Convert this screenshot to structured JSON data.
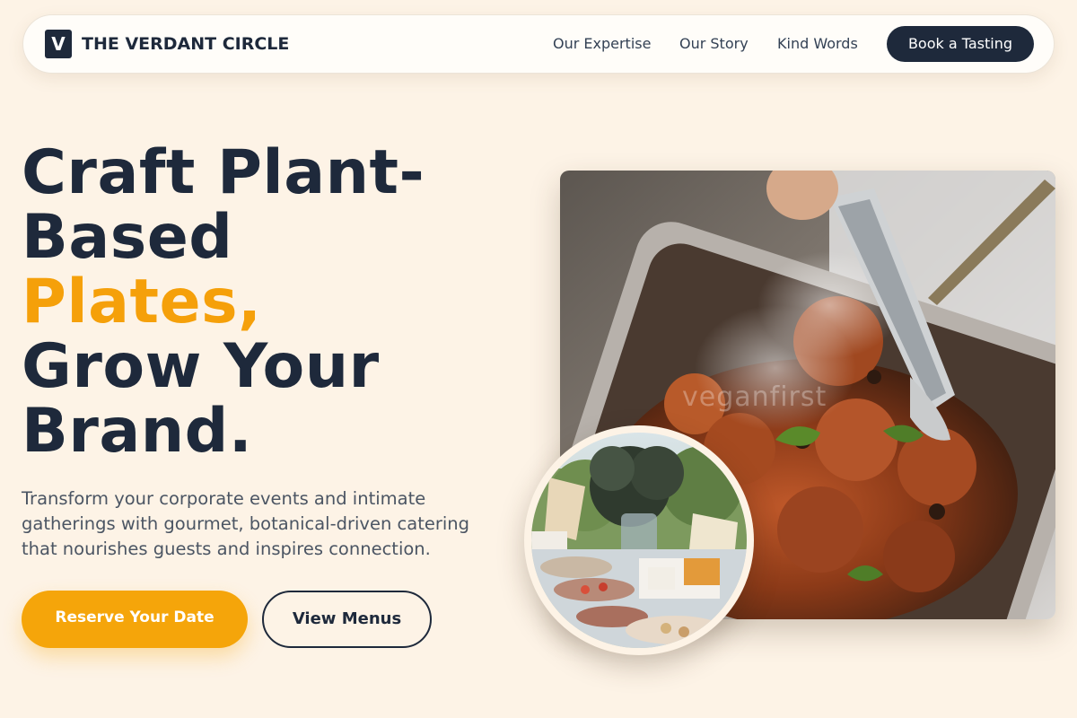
{
  "nav": {
    "logo_letter": "V",
    "brand": "THE VERDANT CIRCLE",
    "links": [
      "Our Expertise",
      "Our Story",
      "Kind Words"
    ],
    "cta": "Book a Tasting"
  },
  "hero": {
    "headline": {
      "line1": "Craft Plant-",
      "line2": "Based",
      "line3_accent": "Plates,",
      "line4": "Grow Your",
      "line5": "Brand."
    },
    "subtext": "Transform your corporate events and intimate gatherings with gourmet, botanical-driven catering that nourishes guests and inspires connection.",
    "primary_button": "Reserve Your Date",
    "secondary_button": "View Menus"
  },
  "images": {
    "main_alt": "Tongs serving grilled plant-based skewers from a steaming chafing dish",
    "main_watermark": "veganfirst",
    "circle_alt": "Outdoor catering buffet table with floral centerpiece and platters"
  },
  "colors": {
    "background": "#fdf3e6",
    "navy": "#1e293b",
    "accent": "#f5a00a"
  }
}
